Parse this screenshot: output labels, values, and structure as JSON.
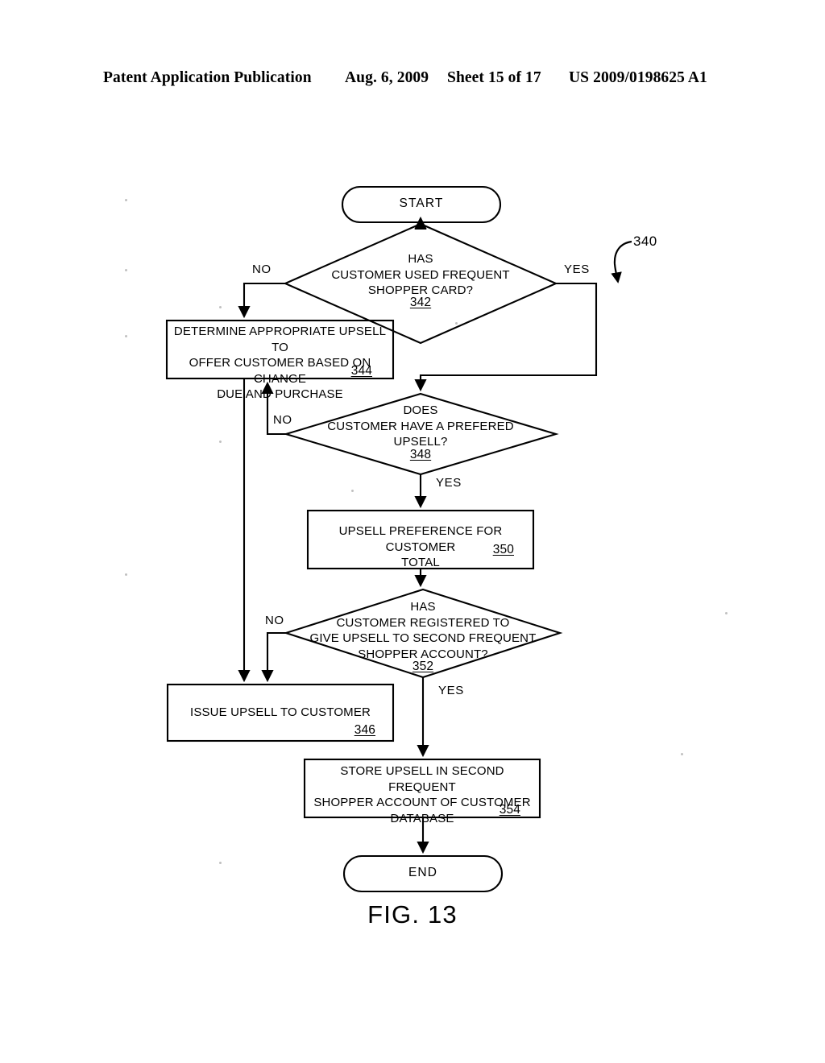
{
  "header": {
    "publication": "Patent Application Publication",
    "date": "Aug. 6, 2009",
    "sheet": "Sheet 15 of 17",
    "patent_number": "US 2009/0198625 A1"
  },
  "figure": {
    "caption": "FIG. 13",
    "reference_numeral": "340"
  },
  "nodes": {
    "start": {
      "label": "START"
    },
    "d342": {
      "text": "HAS\nCUSTOMER USED FREQUENT\nSHOPPER CARD?",
      "ref": "342"
    },
    "b344": {
      "text": "DETERMINE APPROPRIATE UPSELL TO\nOFFER CUSTOMER BASED ON CHANGE\nDUE AND PURCHASE",
      "ref": "344"
    },
    "d348": {
      "text": "DOES\nCUSTOMER HAVE A PREFERED\nUPSELL?",
      "ref": "348"
    },
    "b350": {
      "text": "UPSELL PREFERENCE FOR CUSTOMER\nTOTAL",
      "ref": "350"
    },
    "d352": {
      "text": "HAS\nCUSTOMER REGISTERED TO\nGIVE UPSELL TO SECOND FREQUENT\nSHOPPER ACCOUNT?",
      "ref": "352"
    },
    "b346": {
      "text": "ISSUE UPSELL TO CUSTOMER",
      "ref": "346"
    },
    "b354": {
      "text": "STORE UPSELL IN SECOND FREQUENT\nSHOPPER ACCOUNT OF CUSTOMER\nDATABASE",
      "ref": "354"
    },
    "end": {
      "label": "END"
    }
  },
  "edges": {
    "d342_no": "NO",
    "d342_yes": "YES",
    "d348_no": "NO",
    "d348_yes": "YES",
    "d352_no": "NO",
    "d352_yes": "YES"
  },
  "chart_data": {
    "type": "diagram",
    "subtype": "flowchart",
    "title": "FIG. 13",
    "reference_numeral": "340",
    "nodes": [
      {
        "id": "start",
        "shape": "terminator",
        "text": "START"
      },
      {
        "id": "342",
        "shape": "decision",
        "text": "HAS CUSTOMER USED FREQUENT SHOPPER CARD?"
      },
      {
        "id": "344",
        "shape": "process",
        "text": "DETERMINE APPROPRIATE UPSELL TO OFFER CUSTOMER BASED ON CHANGE DUE AND PURCHASE"
      },
      {
        "id": "348",
        "shape": "decision",
        "text": "DOES CUSTOMER HAVE A PREFERED UPSELL?"
      },
      {
        "id": "350",
        "shape": "process",
        "text": "UPSELL PREFERENCE FOR CUSTOMER TOTAL"
      },
      {
        "id": "352",
        "shape": "decision",
        "text": "HAS CUSTOMER REGISTERED TO GIVE UPSELL TO SECOND FREQUENT SHOPPER ACCOUNT?"
      },
      {
        "id": "346",
        "shape": "process",
        "text": "ISSUE UPSELL TO CUSTOMER"
      },
      {
        "id": "354",
        "shape": "process",
        "text": "STORE UPSELL IN SECOND FREQUENT SHOPPER ACCOUNT OF CUSTOMER DATABASE"
      },
      {
        "id": "end",
        "shape": "terminator",
        "text": "END"
      }
    ],
    "edges": [
      {
        "from": "start",
        "to": "342",
        "label": ""
      },
      {
        "from": "342",
        "to": "344",
        "label": "NO"
      },
      {
        "from": "342",
        "to": "348",
        "label": "YES"
      },
      {
        "from": "344",
        "to": "346",
        "label": ""
      },
      {
        "from": "348",
        "to": "344",
        "label": "NO"
      },
      {
        "from": "348",
        "to": "350",
        "label": "YES"
      },
      {
        "from": "350",
        "to": "352",
        "label": ""
      },
      {
        "from": "352",
        "to": "346",
        "label": "NO"
      },
      {
        "from": "352",
        "to": "354",
        "label": "YES"
      },
      {
        "from": "354",
        "to": "end",
        "label": ""
      }
    ]
  }
}
